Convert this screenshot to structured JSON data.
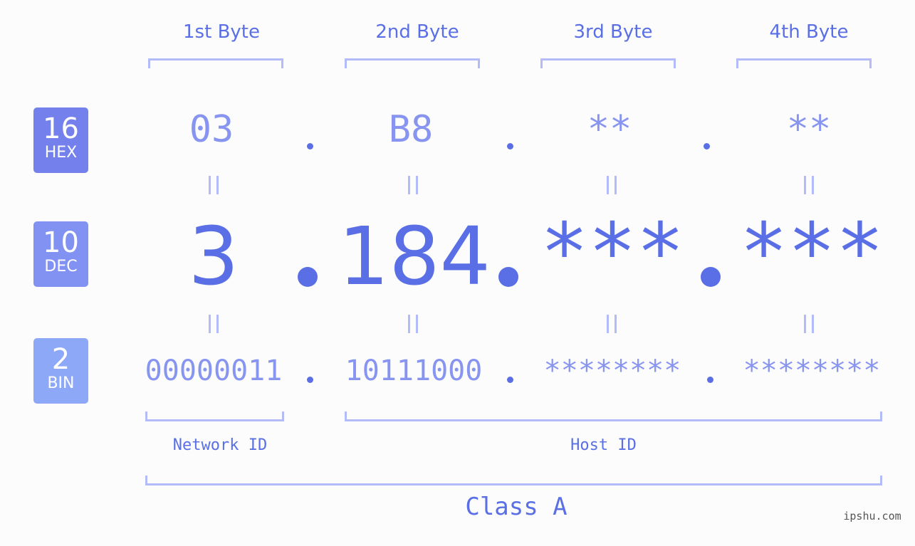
{
  "headers": [
    "1st Byte",
    "2nd Byte",
    "3rd Byte",
    "4th Byte"
  ],
  "badges": {
    "hex": {
      "number": "16",
      "label": "HEX",
      "color": "#7480ec"
    },
    "dec": {
      "number": "10",
      "label": "DEC",
      "color": "#8292f2"
    },
    "bin": {
      "number": "2",
      "label": "BIN",
      "color": "#8ea8f8"
    }
  },
  "hex": [
    "03",
    "B8",
    "**",
    "**"
  ],
  "dec": [
    "3",
    "184",
    "***",
    "***"
  ],
  "bin": [
    "00000011",
    "10111000",
    "********",
    "********"
  ],
  "labels": {
    "network_id": "Network ID",
    "host_id": "Host ID",
    "class": "Class A"
  },
  "watermark": "ipshu.com",
  "colors": {
    "primary": "#5a6fe6",
    "light": "#8794f0",
    "bracket": "#b3bcf8",
    "background": "#fbfcfb"
  }
}
